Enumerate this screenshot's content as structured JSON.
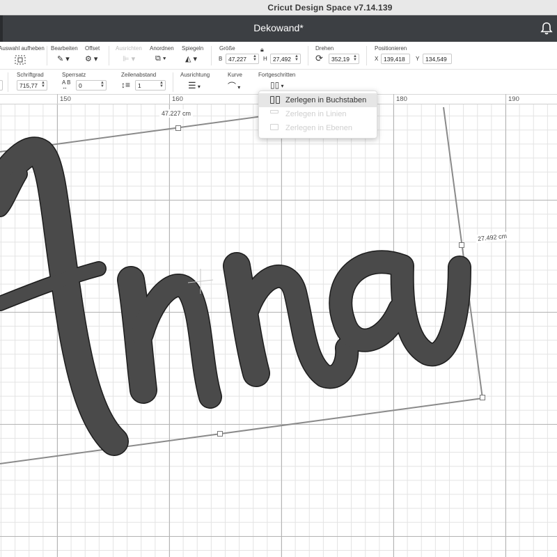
{
  "window": {
    "title": "Cricut Design Space  v7.14.139"
  },
  "header": {
    "document_title": "Dekowand*",
    "bell_icon": "bell-icon"
  },
  "toolbar1": {
    "deselect_label": "Auswahl aufheben",
    "edit_label": "Bearbeiten",
    "offset_label": "Offset",
    "align_label": "Ausrichten",
    "arrange_label": "Anordnen",
    "flip_label": "Spiegeln",
    "size": {
      "label": "Größe",
      "w_label": "B",
      "w_value": "47,227",
      "h_label": "H",
      "h_value": "27,492"
    },
    "rotate": {
      "label": "Drehen",
      "value": "352,19"
    },
    "position": {
      "label": "Positionieren",
      "x_label": "X",
      "x_value": "139,418",
      "y_label": "Y",
      "y_value": "134,549"
    }
  },
  "toolbar2": {
    "font_size": {
      "label": "Schriftgrad",
      "value": "715,77"
    },
    "letter_space": {
      "label": "Sperrsatz",
      "value": "0"
    },
    "line_space": {
      "label": "Zeilenabstand",
      "value": "1"
    },
    "alignment_label": "Ausrichtung",
    "curve_label": "Kurve",
    "advanced_label": "Fortgeschritten"
  },
  "ruler": {
    "ticks": [
      "150",
      "160",
      "170",
      "180",
      "190"
    ]
  },
  "canvas": {
    "text": "Anna",
    "width_dimension": "47.227 cm",
    "height_dimension": "27.492 cm"
  },
  "advanced_menu": {
    "items": [
      {
        "label": "Zerlegen in Buchstaben",
        "state": "hover"
      },
      {
        "label": "Zerlegen in Linien",
        "state": "disabled"
      },
      {
        "label": "Zerlegen in Ebenen",
        "state": "disabled"
      }
    ]
  },
  "colors": {
    "header_bg": "#3c3f43",
    "text_fill": "#444444",
    "menu_hover": "#e6e6e6"
  }
}
